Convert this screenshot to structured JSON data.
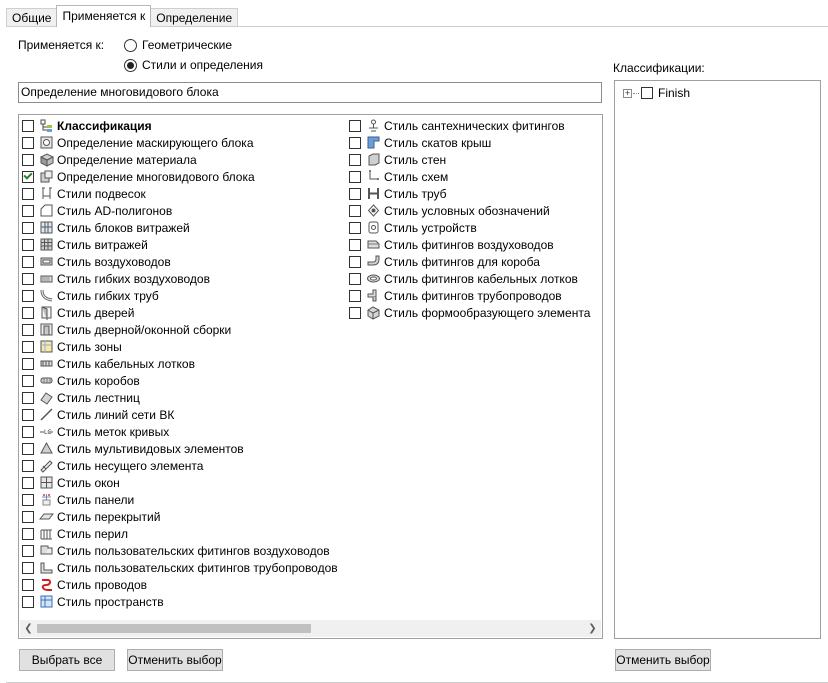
{
  "tabs": [
    {
      "label": "Общие"
    },
    {
      "label": "Применяется к"
    },
    {
      "label": "Определение"
    }
  ],
  "applies_to": {
    "label": "Применяется к:",
    "options": [
      "Геометрические",
      "Стили и определения"
    ],
    "selected": "Стили и определения"
  },
  "name_field": {
    "value": "Определение многовидового блока"
  },
  "list": {
    "col1": [
      {
        "label": "Классификация",
        "icon": "classification-icon",
        "checked": false,
        "bold": true
      },
      {
        "label": "Определение маскирующего блока",
        "icon": "mask-block-icon",
        "checked": false
      },
      {
        "label": "Определение материала",
        "icon": "material-icon",
        "checked": false
      },
      {
        "label": "Определение многовидового блока",
        "icon": "multiview-block-icon",
        "checked": true
      },
      {
        "label": "Стили подвесок",
        "icon": "hanger-icon",
        "checked": false
      },
      {
        "label": "Стиль AD-полигонов",
        "icon": "polygon-icon",
        "checked": false
      },
      {
        "label": "Стиль блоков витражей",
        "icon": "curtain-wall-unit-icon",
        "checked": false
      },
      {
        "label": "Стиль витражей",
        "icon": "curtain-wall-icon",
        "checked": false
      },
      {
        "label": "Стиль воздуховодов",
        "icon": "duct-icon",
        "checked": false
      },
      {
        "label": "Стиль гибких воздуховодов",
        "icon": "flex-duct-icon",
        "checked": false
      },
      {
        "label": "Стиль гибких труб",
        "icon": "flex-pipe-icon",
        "checked": false
      },
      {
        "label": "Стиль дверей",
        "icon": "door-icon",
        "checked": false
      },
      {
        "label": "Стиль дверной/оконной сборки",
        "icon": "door-window-assembly-icon",
        "checked": false
      },
      {
        "label": "Стиль зоны",
        "icon": "zone-icon",
        "checked": false
      },
      {
        "label": "Стиль кабельных лотков",
        "icon": "cable-tray-icon",
        "checked": false
      },
      {
        "label": "Стиль коробов",
        "icon": "conduit-icon",
        "checked": false
      },
      {
        "label": "Стиль лестниц",
        "icon": "stair-icon",
        "checked": false
      },
      {
        "label": "Стиль линий сети ВК",
        "icon": "plumbing-line-icon",
        "checked": false
      },
      {
        "label": "Стиль меток кривых",
        "icon": "curve-label-icon",
        "checked": false
      },
      {
        "label": "Стиль мультивидовых элементов",
        "icon": "multiview-part-icon",
        "checked": false
      },
      {
        "label": "Стиль несущего элемента",
        "icon": "structural-member-icon",
        "checked": false
      },
      {
        "label": "Стиль окон",
        "icon": "window-icon",
        "checked": false
      },
      {
        "label": "Стиль панели",
        "icon": "panel-icon",
        "checked": false
      },
      {
        "label": "Стиль перекрытий",
        "icon": "slab-icon",
        "checked": false
      },
      {
        "label": "Стиль перил",
        "icon": "railing-icon",
        "checked": false
      },
      {
        "label": "Стиль пользовательских фитингов воздуховодов",
        "icon": "custom-duct-fitting-icon",
        "checked": false
      },
      {
        "label": "Стиль пользовательских фитингов трубопроводов",
        "icon": "custom-pipe-fitting-icon",
        "checked": false
      },
      {
        "label": "Стиль проводов",
        "icon": "wire-icon",
        "checked": false
      },
      {
        "label": "Стиль пространств",
        "icon": "space-icon",
        "checked": false
      }
    ],
    "col2": [
      {
        "label": "Стиль сантехнических фитингов",
        "icon": "plumbing-fitting-icon",
        "checked": false
      },
      {
        "label": "Стиль скатов крыш",
        "icon": "roof-slope-icon",
        "checked": false
      },
      {
        "label": "Стиль стен",
        "icon": "wall-icon",
        "checked": false
      },
      {
        "label": "Стиль схем",
        "icon": "schematic-icon",
        "checked": false
      },
      {
        "label": "Стиль труб",
        "icon": "pipe-icon",
        "checked": false
      },
      {
        "label": "Стиль условных обозначений",
        "icon": "symbol-icon",
        "checked": false
      },
      {
        "label": "Стиль устройств",
        "icon": "device-icon",
        "checked": false
      },
      {
        "label": "Стиль фитингов воздуховодов",
        "icon": "duct-fitting-icon",
        "checked": false
      },
      {
        "label": "Стиль фитингов для короба",
        "icon": "conduit-fitting-icon",
        "checked": false
      },
      {
        "label": "Стиль фитингов кабельных лотков",
        "icon": "cable-tray-fitting-icon",
        "checked": false
      },
      {
        "label": "Стиль фитингов трубопроводов",
        "icon": "pipe-fitting-icon",
        "checked": false
      },
      {
        "label": "Стиль формообразующего элемента",
        "icon": "mass-element-icon",
        "checked": false
      }
    ]
  },
  "classifications": {
    "label": "Классификации:",
    "tree": [
      {
        "label": "Finish",
        "checked": false,
        "expanded": false
      }
    ]
  },
  "buttons": {
    "select_all": "Выбрать все",
    "deselect": "Отменить выбор",
    "deselect_class": "Отменить выбор"
  }
}
